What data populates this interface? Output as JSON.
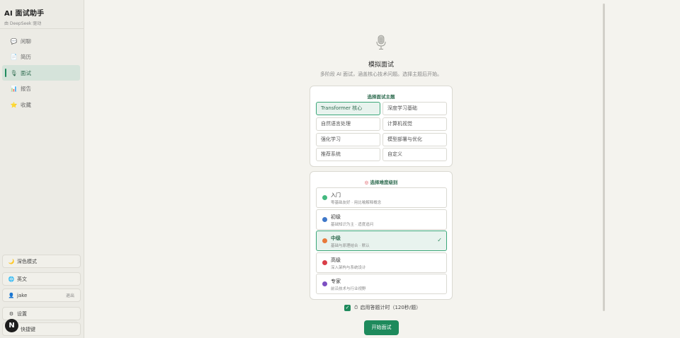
{
  "app": {
    "title": "AI 面试助手",
    "subtitle": "由 DeepSeek 驱动"
  },
  "sidebar": {
    "items": [
      {
        "label": "闲聊",
        "icon": "chat-bubble-icon"
      },
      {
        "label": "简历",
        "icon": "resume-icon"
      },
      {
        "label": "面试",
        "icon": "microphone-icon",
        "active": true
      },
      {
        "label": "报告",
        "icon": "bar-chart-icon"
      },
      {
        "label": "收藏",
        "icon": "star-icon"
      }
    ],
    "bottom": {
      "dark_mode": "深色模式",
      "language": "英文",
      "user": "jake",
      "logout": "退出",
      "settings": "设置",
      "shortcuts": "快捷键"
    },
    "avatar_letter": "N"
  },
  "hero": {
    "title": "模拟面试",
    "subtitle": "多阶段 AI 面试，涵盖核心技术问题。选择主题后开始。"
  },
  "topics": {
    "heading": "选择面试主题",
    "items": [
      {
        "label": "Transformer 核心",
        "selected": true
      },
      {
        "label": "深度学习基础"
      },
      {
        "label": "自然语言处理"
      },
      {
        "label": "计算机视觉"
      },
      {
        "label": "强化学习"
      },
      {
        "label": "模型部署与优化"
      },
      {
        "label": "推荐系统"
      },
      {
        "label": "自定义"
      }
    ]
  },
  "levels": {
    "heading": "选择难度级别",
    "items": [
      {
        "name": "入门",
        "desc": "零基础友好 · 用比喻解释概念",
        "color": "#43b97f"
      },
      {
        "name": "初级",
        "desc": "基础知识为主 · 适度追问",
        "color": "#3f78c9"
      },
      {
        "name": "中级",
        "desc": "基础与原理结合 · 默认",
        "color": "#e8793a",
        "selected": true
      },
      {
        "name": "高级",
        "desc": "深入架构与系统设计",
        "color": "#d93e48"
      },
      {
        "name": "专家",
        "desc": "前沿技术与行业视野",
        "color": "#7d4fc2"
      }
    ]
  },
  "timer": {
    "label": "启用答题计时（120秒/题）",
    "checked": true
  },
  "start_button": "开始面试",
  "colors": {
    "accent": "#1e8a5c",
    "accent_light": "#e8f3ee",
    "background": "#f4f3ee"
  }
}
